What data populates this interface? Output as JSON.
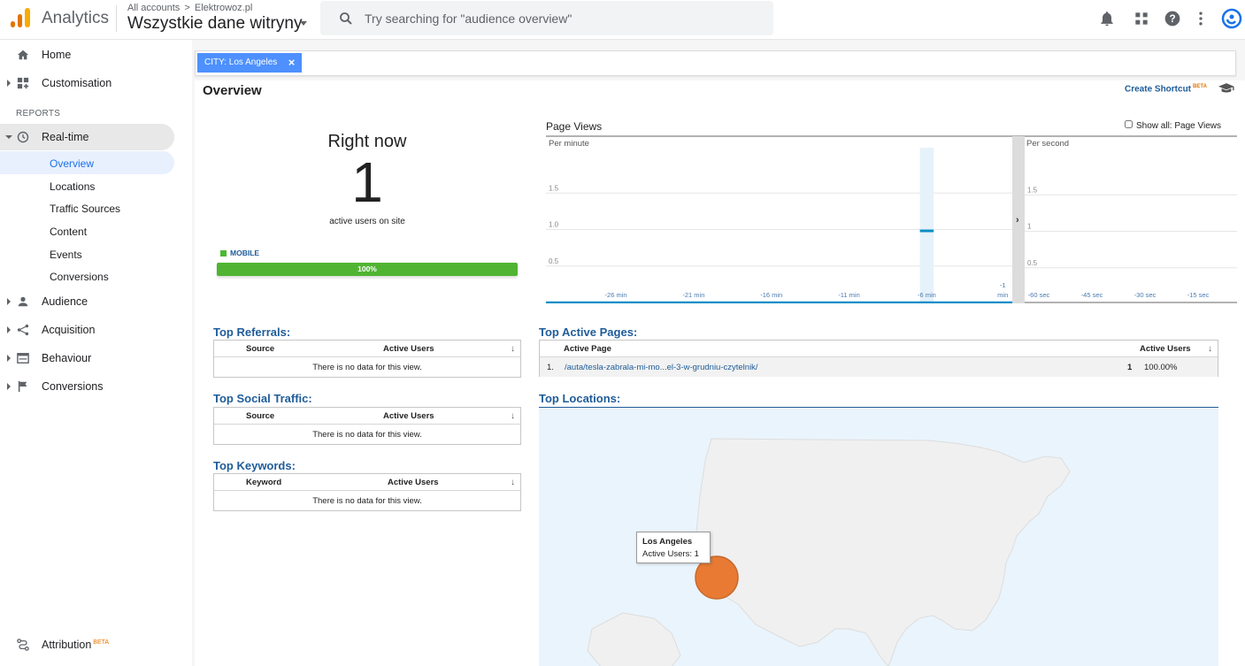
{
  "topbar": {
    "app_name": "Analytics",
    "breadcrumb_all": "All accounts",
    "breadcrumb_sep": ">",
    "breadcrumb_account": "Elektrowoz.pl",
    "view_name": "Wszystkie dane witryny",
    "search_placeholder": "Try searching for \"audience overview\""
  },
  "sidebar": {
    "home": "Home",
    "customisation": "Customisation",
    "reports_label": "REPORTS",
    "realtime": "Real-time",
    "realtime_sub": [
      "Overview",
      "Locations",
      "Traffic Sources",
      "Content",
      "Events",
      "Conversions"
    ],
    "audience": "Audience",
    "acquisition": "Acquisition",
    "behaviour": "Behaviour",
    "conversions": "Conversions",
    "attribution": "Attribution",
    "attribution_badge": "BETA"
  },
  "filter": {
    "chip_label": "CITY: Los Angeles",
    "chip_close": "×"
  },
  "overview": {
    "title": "Overview",
    "shortcut": "Create Shortcut",
    "shortcut_badge": "BETA",
    "right_now_title": "Right now",
    "active_users": "1",
    "active_users_label": "active users on site",
    "device_label": "MOBILE",
    "device_percent": "100%",
    "device_color": "#50b432"
  },
  "pageviews": {
    "title": "Page Views",
    "show_all_label": "Show all: Page Views",
    "per_minute_label": "Per minute",
    "per_second_label": "Per second",
    "minute_y_ticks": [
      "1.5",
      "1.0",
      "0.5"
    ],
    "minute_x_ticks": [
      "-26 min",
      "-21 min",
      "-16 min",
      "-11 min",
      "-6 min",
      "-1 min"
    ],
    "second_y_ticks": [
      "1.5",
      "1",
      "0.5"
    ],
    "second_x_ticks": [
      "-60 sec",
      "-45 sec",
      "-30 sec",
      "-15 sec"
    ]
  },
  "chart_data": {
    "type": "bar",
    "title": "Page Views",
    "series": [
      {
        "name": "Per minute",
        "x": [
          "-30 min",
          "-29 min",
          "-28 min",
          "-27 min",
          "-26 min",
          "-25 min",
          "-24 min",
          "-23 min",
          "-22 min",
          "-21 min",
          "-20 min",
          "-19 min",
          "-18 min",
          "-17 min",
          "-16 min",
          "-15 min",
          "-14 min",
          "-13 min",
          "-12 min",
          "-11 min",
          "-10 min",
          "-9 min",
          "-8 min",
          "-7 min",
          "-6 min",
          "-5 min",
          "-4 min",
          "-3 min",
          "-2 min",
          "-1 min"
        ],
        "values": [
          0,
          0,
          0,
          0,
          0,
          0,
          0,
          0,
          0,
          0,
          0,
          0,
          0,
          0,
          0,
          0,
          0,
          0,
          0,
          0,
          0,
          0,
          0,
          0,
          1,
          0,
          0,
          0,
          0,
          0
        ]
      },
      {
        "name": "Per second",
        "values": []
      }
    ],
    "ylim": [
      0,
      2
    ],
    "grid": true,
    "bar_color": "#058dc7"
  },
  "top_referrals": {
    "title": "Top Referrals:",
    "col_source": "Source",
    "col_users": "Active Users",
    "empty": "There is no data for this view."
  },
  "top_social": {
    "title": "Top Social Traffic:",
    "col_source": "Source",
    "col_users": "Active Users",
    "empty": "There is no data for this view."
  },
  "top_keywords": {
    "title": "Top Keywords:",
    "col_keyword": "Keyword",
    "col_users": "Active Users",
    "empty": "There is no data for this view."
  },
  "top_pages": {
    "title": "Top Active Pages:",
    "col_page": "Active Page",
    "col_users": "Active Users",
    "rows": [
      {
        "index": "1.",
        "page": "/auta/tesla-zabrala-mi-mo...el-3-w-grudniu-czytelnik/",
        "users": "1",
        "percent": "100.00%"
      }
    ]
  },
  "top_locations": {
    "title": "Top Locations:",
    "tooltip_city": "Los Angeles",
    "tooltip_users": "Active Users: 1",
    "bubble_color": "#e87a33"
  }
}
